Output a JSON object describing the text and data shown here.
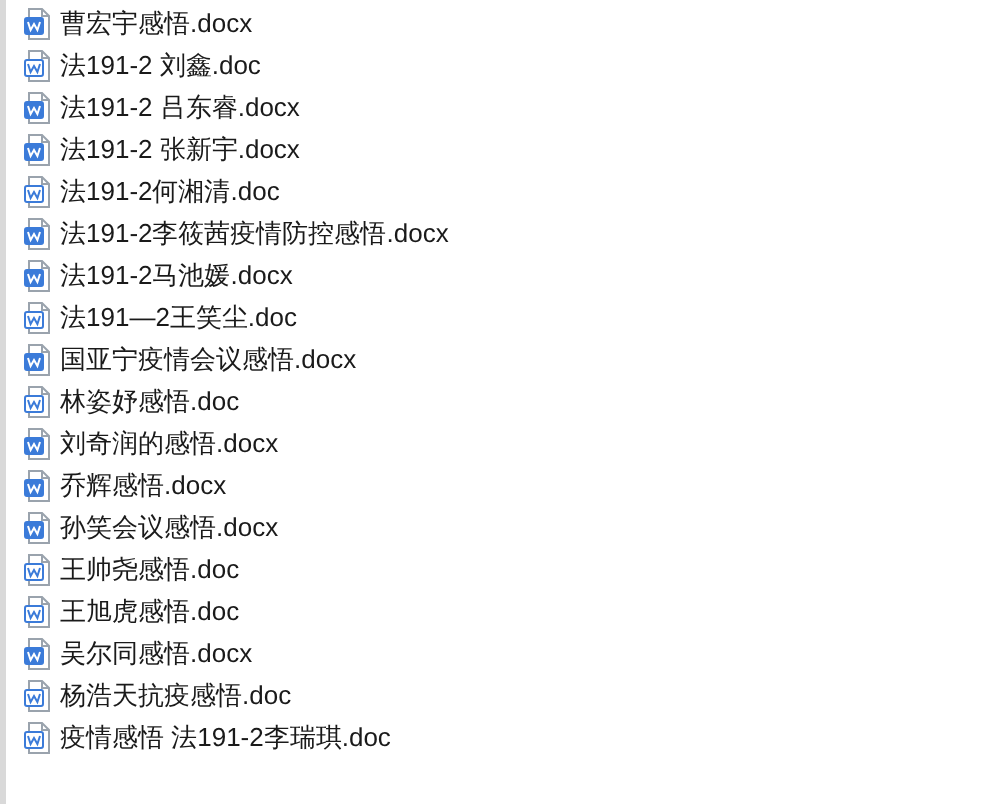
{
  "files": [
    {
      "name": "曹宏宇感悟.docx",
      "kind": "docx"
    },
    {
      "name": "法191-2 刘鑫.doc",
      "kind": "doc"
    },
    {
      "name": "法191-2 吕东睿.docx",
      "kind": "docx"
    },
    {
      "name": "法191-2 张新宇.docx",
      "kind": "docx"
    },
    {
      "name": "法191-2何湘清.doc",
      "kind": "doc"
    },
    {
      "name": "法191-2李筱茜疫情防控感悟.docx",
      "kind": "docx"
    },
    {
      "name": "法191-2马池媛.docx",
      "kind": "docx"
    },
    {
      "name": "法191—2王笑尘.doc",
      "kind": "doc"
    },
    {
      "name": "国亚宁疫情会议感悟.docx",
      "kind": "docx"
    },
    {
      "name": "林姿妤感悟.doc",
      "kind": "doc"
    },
    {
      "name": "刘奇润的感悟.docx",
      "kind": "docx"
    },
    {
      "name": "乔辉感悟.docx",
      "kind": "docx"
    },
    {
      "name": "孙笑会议感悟.docx",
      "kind": "docx"
    },
    {
      "name": "王帅尧感悟.doc",
      "kind": "doc"
    },
    {
      "name": "王旭虎感悟.doc",
      "kind": "doc"
    },
    {
      "name": "吴尔同感悟.docx",
      "kind": "docx"
    },
    {
      "name": "杨浩天抗疫感悟.doc",
      "kind": "doc"
    },
    {
      "name": "疫情感悟 法191-2李瑞琪.doc",
      "kind": "doc"
    }
  ]
}
